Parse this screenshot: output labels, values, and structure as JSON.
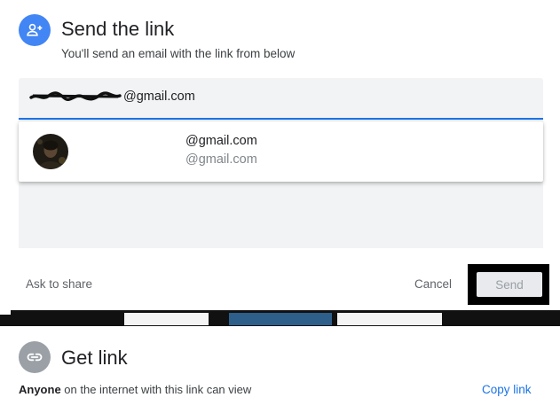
{
  "send_section": {
    "icon": "person-add-icon",
    "title": "Send the link",
    "subtitle": "You'll send an email with the link from below",
    "email_input": {
      "value": "@gmail.com"
    },
    "suggestion": {
      "primary": "@gmail.com",
      "secondary": "@gmail.com"
    },
    "footer": {
      "ask_to_share": "Ask to share",
      "cancel": "Cancel",
      "send": "Send"
    }
  },
  "link_section": {
    "icon": "link-icon",
    "title": "Get link",
    "audience_bold": "Anyone",
    "audience_rest": " on the internet with this link can view",
    "copy_link": "Copy link"
  },
  "colors": {
    "accent_blue": "#1a73e8",
    "icon_blue": "#4285f4",
    "icon_grey": "#9aa0a6",
    "panel_bg": "#f1f3f4"
  }
}
